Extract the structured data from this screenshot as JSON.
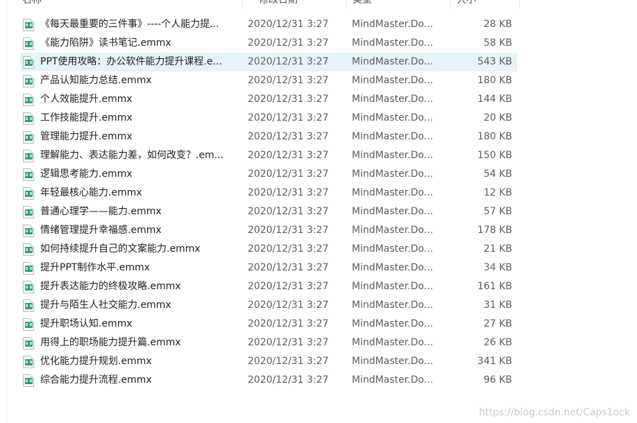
{
  "columns": {
    "name": "名称",
    "date": "修改日期",
    "type": "类型",
    "size": "大小"
  },
  "files": [
    {
      "name": "《每天最重要的三件事》----个人能力提...",
      "date": "2020/12/31 3:27",
      "type": "MindMaster.Do...",
      "size": "28 KB"
    },
    {
      "name": "《能力陷阱》读书笔记.emmx",
      "date": "2020/12/31 3:27",
      "type": "MindMaster.Do...",
      "size": "58 KB"
    },
    {
      "name": "PPT使用攻略：办公软件能力提升课程.e...",
      "date": "2020/12/31 3:27",
      "type": "MindMaster.Do...",
      "size": "543 KB",
      "selected": true
    },
    {
      "name": "产品认知能力总结.emmx",
      "date": "2020/12/31 3:27",
      "type": "MindMaster.Do...",
      "size": "180 KB"
    },
    {
      "name": "个人效能提升.emmx",
      "date": "2020/12/31 3:27",
      "type": "MindMaster.Do...",
      "size": "144 KB"
    },
    {
      "name": "工作技能提升.emmx",
      "date": "2020/12/31 3:27",
      "type": "MindMaster.Do...",
      "size": "20 KB"
    },
    {
      "name": "管理能力提升.emmx",
      "date": "2020/12/31 3:27",
      "type": "MindMaster.Do...",
      "size": "180 KB"
    },
    {
      "name": "理解能力、表达能力差，如何改变？.em...",
      "date": "2020/12/31 3:27",
      "type": "MindMaster.Do...",
      "size": "150 KB"
    },
    {
      "name": "逻辑思考能力.emmx",
      "date": "2020/12/31 3:27",
      "type": "MindMaster.Do...",
      "size": "54 KB"
    },
    {
      "name": "年轻最核心能力.emmx",
      "date": "2020/12/31 3:27",
      "type": "MindMaster.Do...",
      "size": "12 KB"
    },
    {
      "name": "普通心理学——能力.emmx",
      "date": "2020/12/31 3:27",
      "type": "MindMaster.Do...",
      "size": "57 KB"
    },
    {
      "name": "情绪管理提升幸福感.emmx",
      "date": "2020/12/31 3:27",
      "type": "MindMaster.Do...",
      "size": "178 KB"
    },
    {
      "name": "如何持续提升自己的文案能力.emmx",
      "date": "2020/12/31 3:27",
      "type": "MindMaster.Do...",
      "size": "21 KB"
    },
    {
      "name": "提升PPT制作水平.emmx",
      "date": "2020/12/31 3:27",
      "type": "MindMaster.Do...",
      "size": "34 KB"
    },
    {
      "name": "提升表达能力的终极攻略.emmx",
      "date": "2020/12/31 3:27",
      "type": "MindMaster.Do...",
      "size": "161 KB"
    },
    {
      "name": "提升与陌生人社交能力.emmx",
      "date": "2020/12/31 3:27",
      "type": "MindMaster.Do...",
      "size": "31 KB"
    },
    {
      "name": "提升职场认知.emmx",
      "date": "2020/12/31 3:27",
      "type": "MindMaster.Do...",
      "size": "27 KB"
    },
    {
      "name": "用得上的职场能力提升篇.emmx",
      "date": "2020/12/31 3:27",
      "type": "MindMaster.Do...",
      "size": "26 KB"
    },
    {
      "name": "优化能力提升规划.emmx",
      "date": "2020/12/31 3:27",
      "type": "MindMaster.Do...",
      "size": "341 KB"
    },
    {
      "name": "综合能力提升流程.emmx",
      "date": "2020/12/31 3:27",
      "type": "MindMaster.Do...",
      "size": "96 KB"
    }
  ],
  "file_icon": "mindmaster-file-icon",
  "watermark": "https://blog.csdn.net/Caps1ock",
  "colors": {
    "selection": "#e5f3fb",
    "icon_badge": "#2aa26a"
  }
}
